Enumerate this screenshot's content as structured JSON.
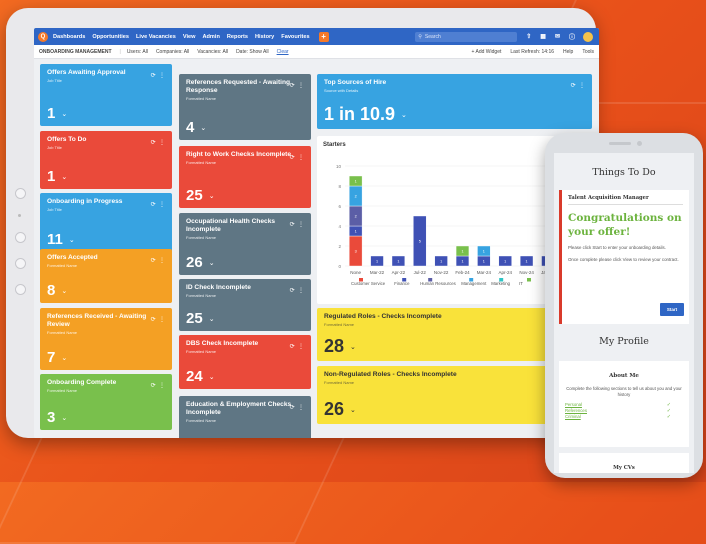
{
  "nav": {
    "items": [
      "Dashboards",
      "Opportunities",
      "Live Vacancies",
      "View",
      "Admin",
      "Reports",
      "History",
      "Favourites"
    ],
    "search_placeholder": "Search",
    "plus": "+"
  },
  "subbar": {
    "section": "ONBOARDING MANAGEMENT",
    "filters": [
      "Users: All",
      "Companies: All",
      "Vacancies: All",
      "Date: Show All"
    ],
    "clear": "Clear",
    "add_widget": "+ Add Widget",
    "last_refresh": "Last Refresh: 14:16",
    "help": "Help",
    "tools": "Tools"
  },
  "col1": [
    {
      "title": "Offers Awaiting Approval",
      "sub": "Job Title",
      "value": "1",
      "color": "blue"
    },
    {
      "title": "Offers To Do",
      "sub": "Job Title",
      "value": "1",
      "color": "red"
    },
    {
      "title": "Onboarding in Progress",
      "sub": "Job Title",
      "value": "11",
      "color": "blue"
    },
    {
      "title": "Offers Accepted",
      "sub": "Formatted Name",
      "value": "8",
      "color": "orange"
    },
    {
      "title": "References Received - Awaiting Review",
      "sub": "Formatted Name",
      "value": "7",
      "color": "orange"
    },
    {
      "title": "Onboarding Complete",
      "sub": "Formatted Name",
      "value": "3",
      "color": "green"
    }
  ],
  "col2": [
    {
      "title": "References Requested - Awaiting Response",
      "sub": "Formatted Name",
      "value": "4",
      "color": "gray"
    },
    {
      "title": "Right to Work Checks Incomplete",
      "sub": "Formatted Name",
      "value": "25",
      "color": "red"
    },
    {
      "title": "Occupational Health Checks Incomplete",
      "sub": "Formatted Name",
      "value": "26",
      "color": "gray"
    },
    {
      "title": "ID Check Incomplete",
      "sub": "Formatted Name",
      "value": "25",
      "color": "gray"
    },
    {
      "title": "DBS Check Incomplete",
      "sub": "Formatted Name",
      "value": "24",
      "color": "red"
    },
    {
      "title": "Education & Employment Checks Incomplete",
      "sub": "Formatted Name",
      "value": "",
      "color": "gray"
    }
  ],
  "col3": [
    {
      "title": "Top Sources of Hire",
      "sub": "Source with Details",
      "value": "1 in 10.9",
      "color": "blue"
    },
    {
      "title": "Regulated Roles - Checks Incomplete",
      "sub": "Formatted Name",
      "value": "28",
      "color": "yellow"
    },
    {
      "title": "Non-Regulated Roles - Checks Incomplete",
      "sub": "Formatted Name",
      "value": "26",
      "color": "yellow"
    }
  ],
  "chart": {
    "title": "Starters"
  },
  "chart_data": {
    "type": "bar",
    "title": "Starters",
    "categories": [
      "None",
      "Mar-22",
      "Apr-22",
      "Jul-22",
      "Nov-22",
      "Feb-24",
      "Mar-24",
      "Apr-24",
      "Nov-24",
      "Jan-25",
      "Gri"
    ],
    "ylim": [
      0,
      10
    ],
    "yticks": [
      0,
      2,
      4,
      6,
      8,
      10
    ],
    "series": [
      {
        "name": "Customer Service",
        "color": "#ea4a3a",
        "values": [
          3,
          0,
          0,
          0,
          0,
          0,
          0,
          0,
          0,
          0,
          0
        ]
      },
      {
        "name": "Finance",
        "color": "#3f51b5",
        "values": [
          1,
          1,
          1,
          5,
          1,
          1,
          1,
          1,
          1,
          1,
          0
        ]
      },
      {
        "name": "Human Resources",
        "color": "#5b5ea6",
        "values": [
          2,
          0,
          0,
          0,
          0,
          0,
          0,
          0,
          0,
          0,
          0
        ]
      },
      {
        "name": "Management",
        "color": "#37a3e1",
        "values": [
          2,
          0,
          0,
          0,
          0,
          0,
          1,
          0,
          0,
          0,
          0
        ]
      },
      {
        "name": "Marketing",
        "color": "#2ec4c4",
        "values": [
          0,
          0,
          0,
          0,
          0,
          0,
          0,
          0,
          0,
          0,
          0
        ]
      },
      {
        "name": "IT",
        "color": "#79c04c",
        "values": [
          1,
          0,
          0,
          0,
          0,
          1,
          0,
          0,
          0,
          0,
          0
        ]
      },
      {
        "name": "Goods",
        "color": "#f9e23a",
        "values": [
          0,
          0,
          0,
          0,
          0,
          0,
          0,
          0,
          0,
          0,
          1
        ]
      }
    ],
    "data_labels": [
      [
        3,
        1,
        2,
        2,
        1
      ],
      [
        1
      ],
      [
        1
      ],
      [
        5
      ],
      [
        1
      ],
      [
        1,
        1
      ],
      [
        1,
        1
      ],
      [
        1
      ],
      [
        1
      ],
      [
        1
      ],
      []
    ],
    "legend": "bottom",
    "grid": true
  },
  "phone": {
    "things_title": "Things To Do",
    "role": "Talent Acquisition Manager",
    "congrats": "Congratulations on your offer!",
    "p1": "Please click Start to enter your onboarding details.",
    "p2": "Once complete please click View to review your contract.",
    "start": "Start",
    "profile_title": "My Profile",
    "about_title": "About Me",
    "about_text": "Complete the following sections to tell us about you and your history",
    "links": [
      "Personal",
      "References",
      "Criminal"
    ],
    "mycvs": "My CVs"
  }
}
